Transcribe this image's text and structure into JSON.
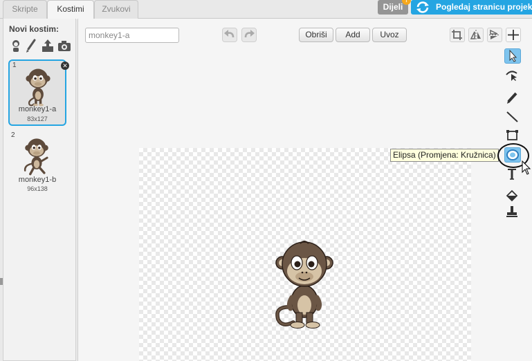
{
  "tabs": [
    {
      "label": "Skripte",
      "active": false
    },
    {
      "label": "Kostimi",
      "active": true
    },
    {
      "label": "Zvukovi",
      "active": false
    }
  ],
  "header": {
    "share_label": "Dijeli",
    "share_badge": "!",
    "project_page_label": "Pogledaj stranicu projekta"
  },
  "left_panel": {
    "new_costume_label": "Novi kostim:",
    "new_costume_icons": [
      "sprite-library-icon",
      "paint-brush-icon",
      "upload-icon",
      "camera-icon"
    ],
    "costumes": [
      {
        "number": "1",
        "name": "monkey1-a",
        "size": "83x127",
        "selected": true
      },
      {
        "number": "2",
        "name": "monkey1-b",
        "size": "96x138",
        "selected": false
      }
    ]
  },
  "editor": {
    "costume_name_value": "monkey1-a",
    "clear_label": "Obriši",
    "add_label": "Add",
    "import_label": "Uvoz",
    "top_tools": [
      "crop-icon",
      "flip-horizontal-icon",
      "flip-vertical-icon",
      "crosshair-icon"
    ],
    "side_tools": [
      "select-icon",
      "reshape-icon",
      "pencil-icon",
      "line-icon",
      "rectangle-icon",
      "ellipse-icon",
      "text-icon",
      "fill-icon",
      "stamp-icon"
    ],
    "active_tool": "ellipse-icon",
    "tooltip": "Elipsa (Promjena: Kružnica)"
  },
  "colors": {
    "accent": "#25a5e2",
    "share": "#959595",
    "badge": "#f7a81b",
    "tooltip_bg": "#ffffdd"
  }
}
